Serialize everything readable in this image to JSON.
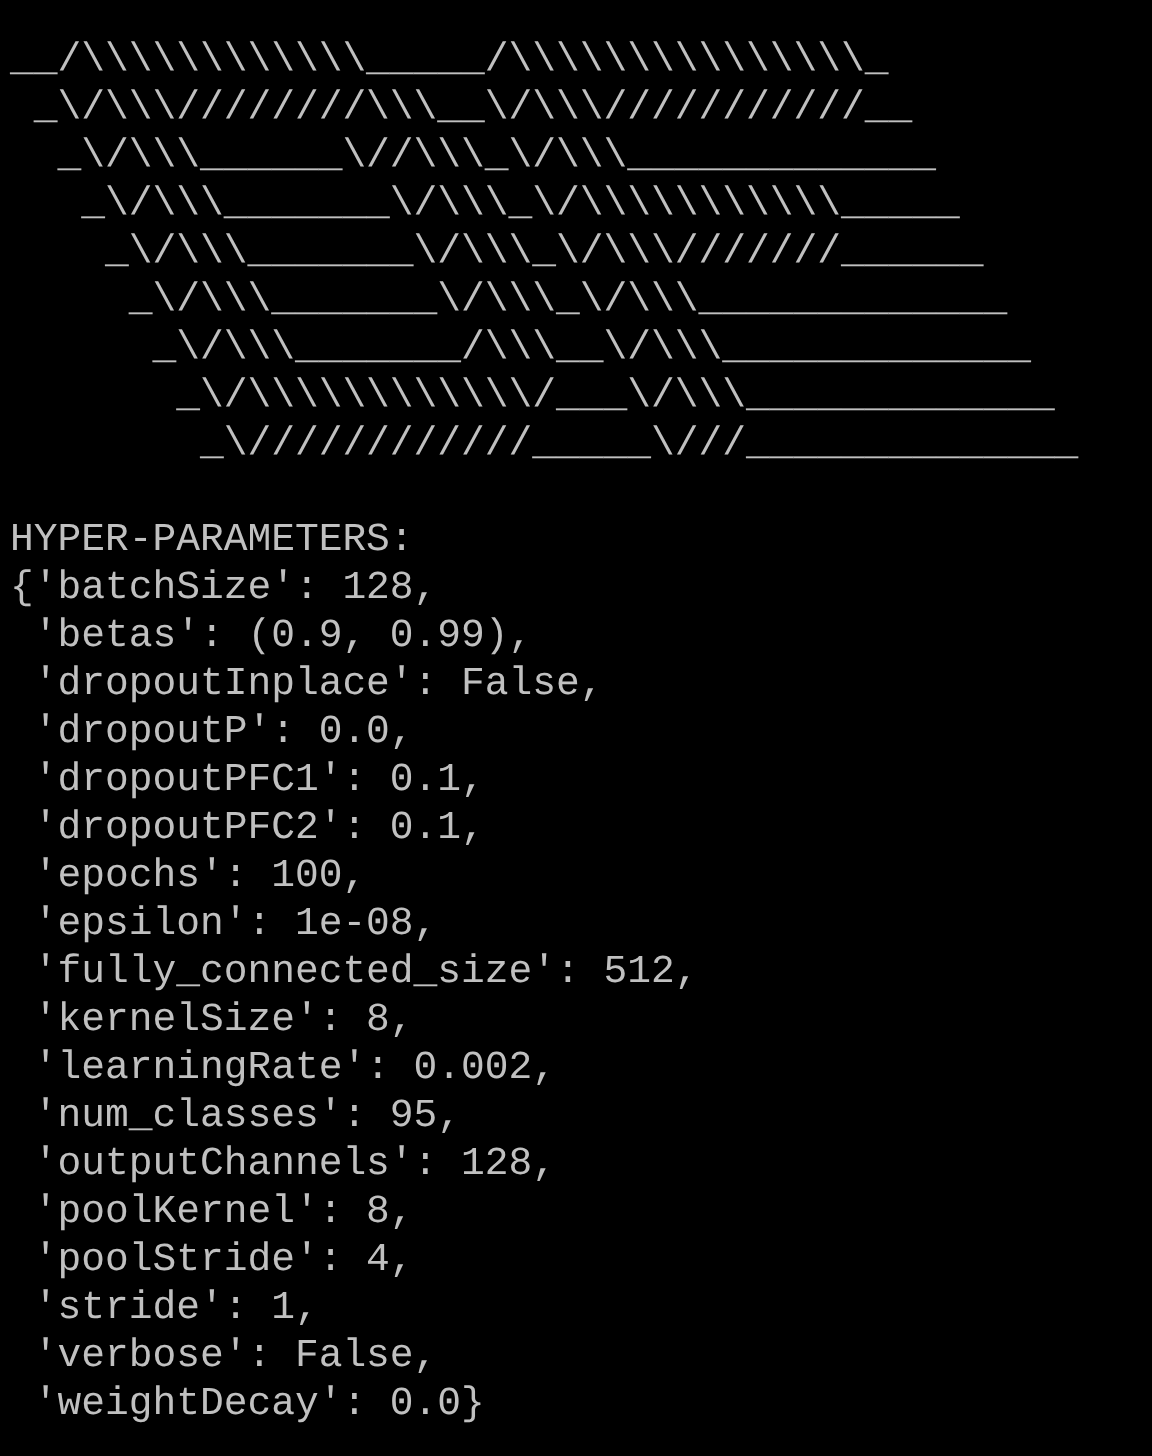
{
  "ascii_banner": [
    "__/\\\\\\\\\\\\\\\\\\\\\\\\_____/\\\\\\\\\\\\\\\\\\\\\\\\\\\\\\_",
    " _\\/\\\\\\////////\\\\\\__\\/\\\\\\///////////__",
    "  _\\/\\\\\\______\\//\\\\\\_\\/\\\\\\_____________",
    "   _\\/\\\\\\_______\\/\\\\\\_\\/\\\\\\\\\\\\\\\\\\\\\\_____",
    "    _\\/\\\\\\_______\\/\\\\\\_\\/\\\\\\///////______",
    "     _\\/\\\\\\_______\\/\\\\\\_\\/\\\\\\_____________",
    "      _\\/\\\\\\_______/\\\\\\__\\/\\\\\\_____________",
    "       _\\/\\\\\\\\\\\\\\\\\\\\\\\\/___\\/\\\\\\_____________",
    "        _\\////////////_____\\///______________"
  ],
  "output": {
    "heading": "HYPER-PARAMETERS:",
    "lines": [
      "{'batchSize': 128,",
      " 'betas': (0.9, 0.99),",
      " 'dropoutInplace': False,",
      " 'dropoutP': 0.0,",
      " 'dropoutPFC1': 0.1,",
      " 'dropoutPFC2': 0.1,",
      " 'epochs': 100,",
      " 'epsilon': 1e-08,",
      " 'fully_connected_size': 512,",
      " 'kernelSize': 8,",
      " 'learningRate': 0.002,",
      " 'num_classes': 95,",
      " 'outputChannels': 128,",
      " 'poolKernel': 8,",
      " 'poolStride': 4,",
      " 'stride': 1,",
      " 'verbose': False,",
      " 'weightDecay': 0.0}"
    ]
  }
}
